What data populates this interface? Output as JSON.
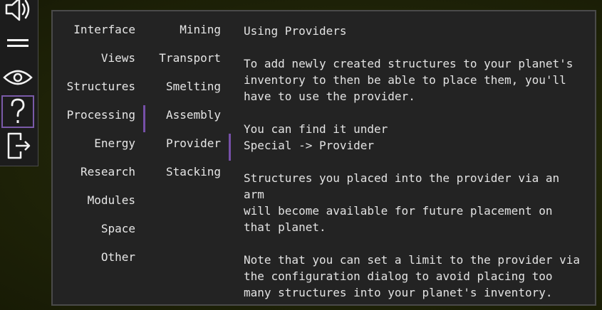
{
  "toolbar": {
    "items": [
      {
        "icon": "speaker-icon",
        "active": false
      },
      {
        "icon": "menu-lines-icon",
        "active": false
      },
      {
        "icon": "eye-icon",
        "active": false
      },
      {
        "icon": "question-mark-icon",
        "active": true
      },
      {
        "icon": "exit-door-icon",
        "active": false
      }
    ],
    "active_color": "#7a5aa8"
  },
  "categories": [
    {
      "label": "Interface",
      "selected": false
    },
    {
      "label": "Views",
      "selected": false
    },
    {
      "label": "Structures",
      "selected": false
    },
    {
      "label": "Processing",
      "selected": true
    },
    {
      "label": "Energy",
      "selected": false
    },
    {
      "label": "Research",
      "selected": false
    },
    {
      "label": "Modules",
      "selected": false
    },
    {
      "label": "Space",
      "selected": false
    },
    {
      "label": "Other",
      "selected": false
    }
  ],
  "topics": [
    {
      "label": "Mining",
      "selected": false
    },
    {
      "label": "Transport",
      "selected": false
    },
    {
      "label": "Smelting",
      "selected": false
    },
    {
      "label": "Assembly",
      "selected": false
    },
    {
      "label": "Provider",
      "selected": true
    },
    {
      "label": "Stacking",
      "selected": false
    }
  ],
  "article": {
    "title": "Using Providers",
    "paragraphs": [
      "To add newly created structures to your planet's\ninventory to then be able to place them, you'll\nhave to use the provider.",
      "You can find it under\nSpecial -> Provider",
      "Structures you placed into the provider via an arm\nwill become available for future placement on\nthat planet.",
      "Note that you can set a limit to the provider via\nthe configuration dialog to avoid placing too\nmany structures into your planet's inventory."
    ]
  },
  "colors": {
    "selection_bar": "#7650a8",
    "panel_bg": "#232323",
    "panel_border": "#4a4a4a",
    "text": "#e6e6e6"
  }
}
